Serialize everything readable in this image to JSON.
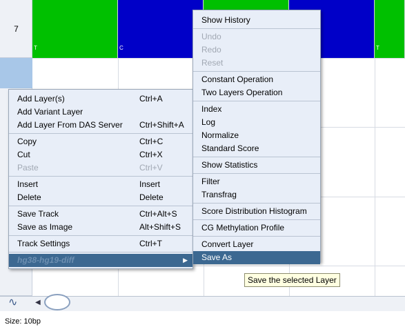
{
  "grid": {
    "row_number": "7",
    "top_cells": [
      {
        "color": "#00c000",
        "letter": "T"
      },
      {
        "color": "#0000c8",
        "letter": "C"
      },
      {
        "color": "#00c000",
        "letter": ""
      },
      {
        "color": "#0000c8",
        "letter": ""
      },
      {
        "color": "#00c000",
        "letter": "T"
      }
    ]
  },
  "context_menu": {
    "groups": [
      [
        {
          "label": "Add Layer(s)",
          "shortcut": "Ctrl+A",
          "enabled": true
        },
        {
          "label": "Add Variant Layer",
          "shortcut": "",
          "enabled": true
        },
        {
          "label": "Add Layer From DAS Server",
          "shortcut": "Ctrl+Shift+A",
          "enabled": true
        }
      ],
      [
        {
          "label": "Copy",
          "shortcut": "Ctrl+C",
          "enabled": true
        },
        {
          "label": "Cut",
          "shortcut": "Ctrl+X",
          "enabled": true
        },
        {
          "label": "Paste",
          "shortcut": "Ctrl+V",
          "enabled": false
        }
      ],
      [
        {
          "label": "Insert",
          "shortcut": "Insert",
          "enabled": true
        },
        {
          "label": "Delete",
          "shortcut": "Delete",
          "enabled": true
        }
      ],
      [
        {
          "label": "Save Track",
          "shortcut": "Ctrl+Alt+S",
          "enabled": true
        },
        {
          "label": "Save as Image",
          "shortcut": "Alt+Shift+S",
          "enabled": true
        }
      ],
      [
        {
          "label": "Track Settings",
          "shortcut": "Ctrl+T",
          "enabled": true
        }
      ]
    ],
    "submenu_trigger": {
      "label": "hg38-hg19-diff",
      "arrow": "▶"
    }
  },
  "submenu": {
    "groups": [
      [
        {
          "label": "Show History",
          "enabled": true
        }
      ],
      [
        {
          "label": "Undo",
          "enabled": false
        },
        {
          "label": "Redo",
          "enabled": false
        },
        {
          "label": "Reset",
          "enabled": false
        }
      ],
      [
        {
          "label": "Constant Operation",
          "enabled": true
        },
        {
          "label": "Two Layers Operation",
          "enabled": true
        }
      ],
      [
        {
          "label": "Index",
          "enabled": true
        },
        {
          "label": "Log",
          "enabled": true
        },
        {
          "label": "Normalize",
          "enabled": true
        },
        {
          "label": "Standard Score",
          "enabled": true
        }
      ],
      [
        {
          "label": "Show Statistics",
          "enabled": true
        }
      ],
      [
        {
          "label": "Filter",
          "enabled": true
        },
        {
          "label": "Transfrag",
          "enabled": true
        }
      ],
      [
        {
          "label": "Score Distribution Histogram",
          "enabled": true
        }
      ],
      [
        {
          "label": "CG Methylation Profile",
          "enabled": true
        }
      ],
      [
        {
          "label": "Convert Layer",
          "enabled": true
        },
        {
          "label": "Save As",
          "enabled": true,
          "selected": true
        }
      ]
    ]
  },
  "tooltip": {
    "text": "Save the selected Layer"
  },
  "status_bar": {
    "text": "Size: 10bp"
  },
  "colors": {
    "menu_bg": "#e8eef8",
    "selection": "#3c6891",
    "green_cell": "#00c000",
    "blue_cell": "#0000c8"
  }
}
